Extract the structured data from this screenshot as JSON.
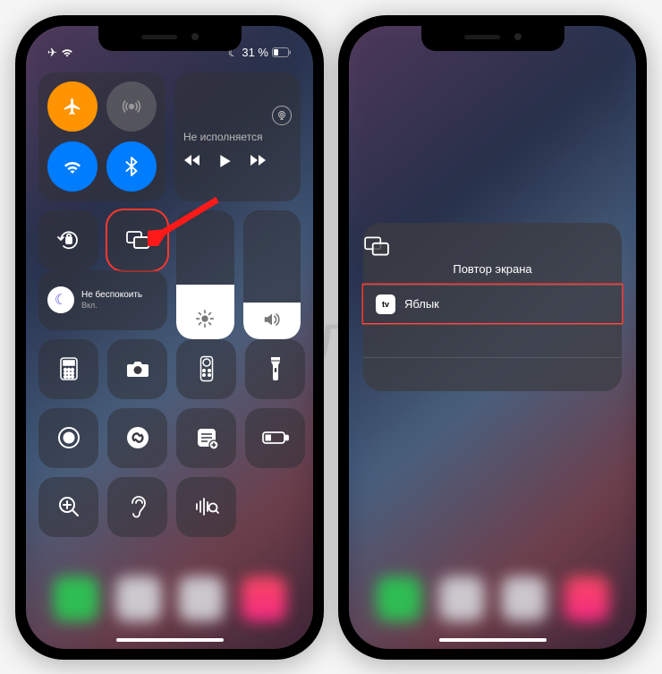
{
  "status": {
    "battery_text": "31 %"
  },
  "media": {
    "now_playing": "Не исполняется"
  },
  "dnd": {
    "title": "Не беспокоить",
    "state": "Вкл."
  },
  "mirror_panel": {
    "title": "Повтор экрана",
    "device_name": "Яблык"
  },
  "watermark": "Яблык"
}
